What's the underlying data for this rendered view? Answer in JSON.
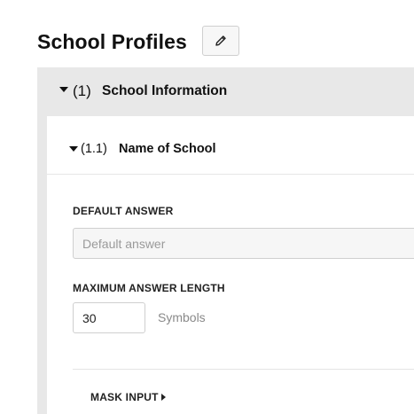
{
  "page": {
    "title": "School Profiles"
  },
  "edit": {
    "icon": "pencil-icon"
  },
  "section": {
    "number": "(1)",
    "title": "School Information",
    "expanded": true
  },
  "subsection": {
    "number": "(1.1)",
    "title": "Name of School",
    "expanded": true
  },
  "default_answer": {
    "label": "DEFAULT ANSWER",
    "value": "",
    "placeholder": "Default answer"
  },
  "max_length": {
    "label": "MAXIMUM ANSWER LENGTH",
    "value": "30",
    "unit": "Symbols"
  },
  "mask_input": {
    "label": "MASK INPUT",
    "expanded": false
  },
  "colors": {
    "section_bg": "#e8e8e8",
    "border": "#cfcfcf",
    "text": "#111111",
    "muted": "#8a8a8a"
  }
}
